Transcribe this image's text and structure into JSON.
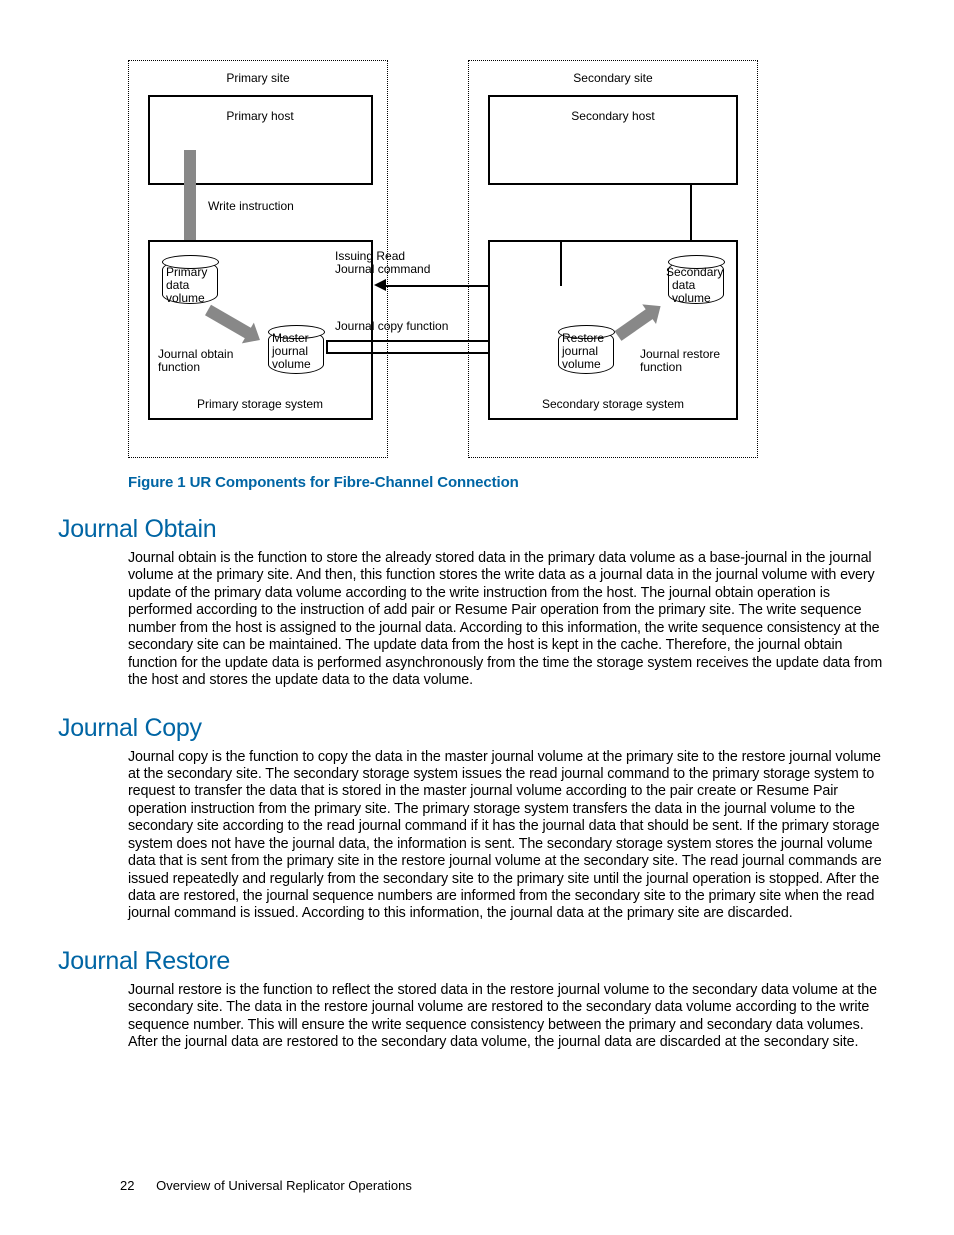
{
  "figure": {
    "primary_site": "Primary site",
    "primary_host": "Primary host",
    "write_instruction": "Write instruction",
    "primary_data_volume_l1": "Primary",
    "primary_data_volume_l2": "data",
    "primary_data_volume_l3": "volume",
    "master_journal_l1": "Master",
    "master_journal_l2": "journal",
    "master_journal_l3": "volume",
    "journal_obtain_l1": "Journal obtain",
    "journal_obtain_l2": "function",
    "primary_storage": "Primary storage system",
    "issuing_read_l1": "Issuing Read",
    "issuing_read_l2": "Journal command",
    "journal_copy_function": "Journal copy function",
    "secondary_site": "Secondary site",
    "secondary_host": "Secondary host",
    "restore_journal_l1": "Restore",
    "restore_journal_l2": "journal",
    "restore_journal_l3": "volume",
    "secondary_data_l1": "Secondary",
    "secondary_data_l2": "data",
    "secondary_data_l3": "volume",
    "journal_restore_l1": "Journal restore",
    "journal_restore_l2": "function",
    "secondary_storage": "Secondary storage system",
    "caption": "Figure 1 UR Components for Fibre-Channel Connection"
  },
  "sections": {
    "obtain": {
      "heading": "Journal Obtain",
      "body": "Journal obtain is the function to store the already stored data in the primary data volume as a base-journal in the journal volume at the primary site. And then, this function stores the write data as a journal data in the journal volume with every update of the primary data volume according to the write instruction from the host. The journal obtain operation is performed according to the instruction of add pair or Resume Pair operation from the primary site. The write sequence number from the host is assigned to the journal data. According to this information, the write sequence consistency at the secondary site can be maintained. The update data from the host is kept in the cache. Therefore, the journal obtain function for the update data is performed asynchronously from the time the storage system receives the update data from the host and stores the update data to the data volume."
    },
    "copy": {
      "heading": "Journal Copy",
      "body": "Journal copy is the function to copy the data in the master journal volume at the primary site to the restore journal volume at the secondary site. The secondary storage system issues the read journal command to the primary storage system to request to transfer the data that is stored in the master journal volume according to the pair create or Resume Pair operation instruction from the primary site. The primary storage system transfers the data in the journal volume to the secondary site according to the read journal command if it has the journal data that should be sent. If the primary storage system does not have the journal data, the information is sent. The secondary storage system stores the journal volume data that is sent from the primary site in the restore journal volume at the secondary site. The read journal commands are issued repeatedly and regularly from the secondary site to the primary site until the journal operation is stopped. After the data are restored, the journal sequence numbers are informed from the secondary site to the primary site when the read journal command is issued. According to this information, the journal data at the primary site are discarded."
    },
    "restore": {
      "heading": "Journal Restore",
      "body": "Journal restore is the function to reflect the stored data in the restore journal volume to the secondary data volume at the secondary site. The data in the restore journal volume are restored to the secondary data volume according to the write sequence number. This will ensure the write sequence consistency between the primary and secondary data volumes. After the journal data are restored to the secondary data volume, the journal data are discarded at the secondary site."
    }
  },
  "footer": {
    "page_number": "22",
    "title": "Overview of Universal Replicator Operations"
  }
}
